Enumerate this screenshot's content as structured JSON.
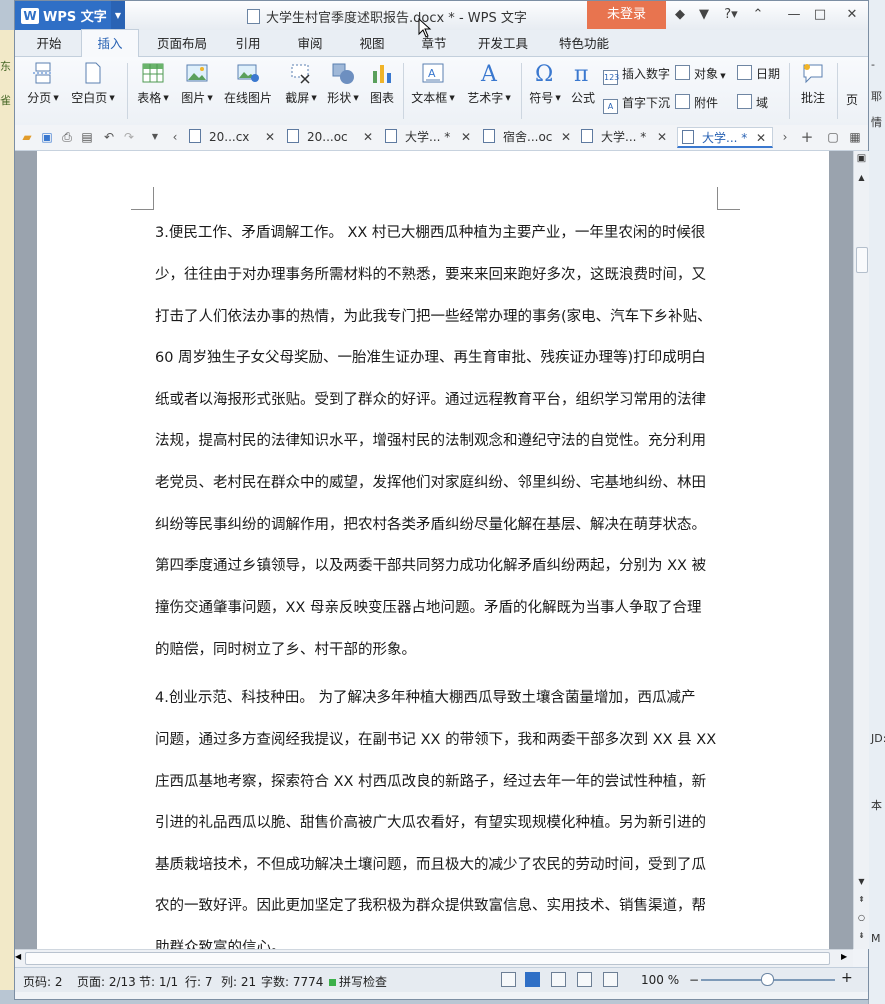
{
  "app": {
    "name": "WPS 文字",
    "window_title": "大学生村官季度述职报告.docx * - WPS 文字",
    "login_label": "未登录"
  },
  "menu": {
    "tabs": [
      "开始",
      "插入",
      "页面布局",
      "引用",
      "审阅",
      "视图",
      "章节",
      "开发工具",
      "特色功能"
    ],
    "active": "插入"
  },
  "ribbon": {
    "fenye": "分页",
    "kongbaiye": "空白页",
    "biaoge": "表格",
    "tupian": "图片",
    "zaixian_tupian": "在线图片",
    "jieping": "截屏",
    "xingzhuang": "形状",
    "tubiao": "图表",
    "wenbenkuang": "文本框",
    "yishuzi": "艺术字",
    "fuhao": "符号",
    "gongshi": "公式",
    "charu_shuzi": "插入数字",
    "duixiang": "对象",
    "riqi": "日期",
    "shouzi_xiachen": "首字下沉",
    "fujian": "附件",
    "yu": "域",
    "pizhu": "批注",
    "ye": "页"
  },
  "doc_tabs": [
    {
      "label": "20...cx"
    },
    {
      "label": "20...oc"
    },
    {
      "label": "大学... *"
    },
    {
      "label": "宿舍...oc"
    },
    {
      "label": "大学... *"
    },
    {
      "label": "大学... *"
    }
  ],
  "document": {
    "para1": [
      "3.便民工作、矛盾调解工作。 XX 村已大棚西瓜种植为主要产业，一年里农闲的时候很",
      "少，往往由于对办理事务所需材料的不熟悉，要来来回来跑好多次，这既浪费时间，又",
      "打击了人们依法办事的热情，为此我专门把一些经常办理的事务(家电、汽车下乡补贴、",
      "60 周岁独生子女父母奖励、一胎准生证办理、再生育审批、残疾证办理等)打印成明白",
      "纸或者以海报形式张贴。受到了群众的好评。通过远程教育平台，组织学习常用的法律",
      "法规，提高村民的法律知识水平，增强村民的法制观念和遵纪守法的自觉性。充分利用",
      "老党员、老村民在群众中的威望，发挥他们对家庭纠纷、邻里纠纷、宅基地纠纷、林田",
      "纠纷等民事纠纷的调解作用，把农村各类矛盾纠纷尽量化解在基层、解决在萌芽状态。",
      "第四季度通过乡镇领导，以及两委干部共同努力成功化解矛盾纠纷两起，分别为 XX 被",
      "撞伤交通肇事问题，XX 母亲反映变压器占地问题。矛盾的化解既为当事人争取了合理",
      "的赔偿，同时树立了乡、村干部的形象。"
    ],
    "para2": [
      "4.创业示范、科技种田。 为了解决多年种植大棚西瓜导致土壤含菌量增加，西瓜减产",
      "问题，通过多方查阅经我提议，在副书记 XX 的带领下，我和两委干部多次到 XX 县 XX",
      "庄西瓜基地考察，探索符合 XX 村西瓜改良的新路子，经过去年一年的尝试性种植，新",
      "引进的礼品西瓜以脆、甜售价高被广大瓜农看好，有望实现规模化种植。另为新引进的",
      "基质栽培技术，不但成功解决土壤问题，而且极大的减少了农民的劳动时间，受到了瓜",
      "农的一致好评。因此更加坚定了我积极为群众提供致富信息、实用技术、销售渠道，帮",
      "助群众致富的信心。"
    ]
  },
  "status": {
    "page_code": "页码: 2",
    "pages": "页面: 2/13",
    "section": "节: 1/1",
    "row": "行: 7",
    "col": "列: 21",
    "words": "字数: 7774",
    "spell": "拼写检查",
    "zoom": "100 %",
    "zoom_fraction": 0.5
  },
  "desktop": {
    "right_fragments": [
      "-",
      "耶",
      "情",
      "JD:",
      "本",
      "M"
    ],
    "left_fragments": [
      "东",
      "雀"
    ]
  }
}
